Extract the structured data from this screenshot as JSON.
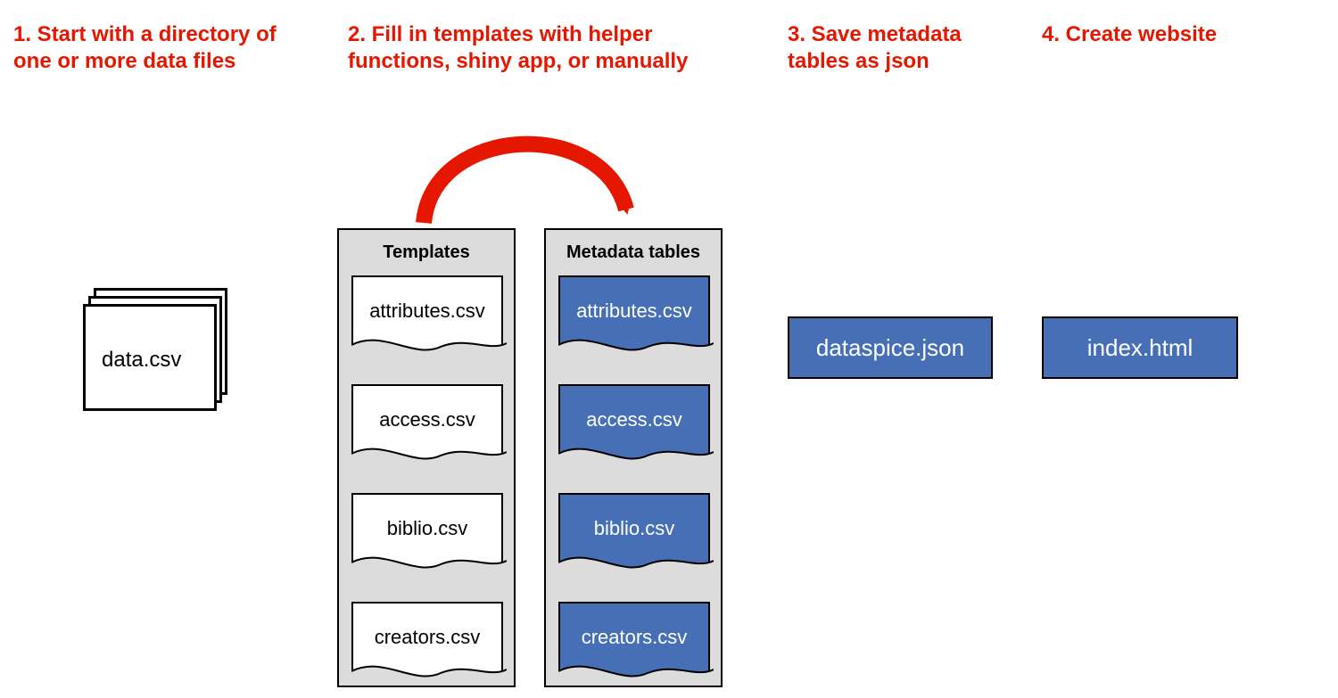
{
  "steps": {
    "s1": "1. Start with a directory of one or more data files",
    "s2": "2. Fill in templates with helper functions, shiny app, or manually",
    "s3": "3. Save metadata tables as json",
    "s4": "4. Create website"
  },
  "data_file": {
    "label": "data.csv"
  },
  "templates_panel": {
    "title": "Templates",
    "files": [
      "attributes.csv",
      "access.csv",
      "biblio.csv",
      "creators.csv"
    ]
  },
  "metadata_panel": {
    "title": "Metadata tables",
    "files": [
      "attributes.csv",
      "access.csv",
      "biblio.csv",
      "creators.csv"
    ]
  },
  "json_file": {
    "label": "dataspice.json"
  },
  "html_file": {
    "label": "index.html"
  },
  "colors": {
    "accent_red": "#e51700",
    "box_blue": "#466fb5",
    "panel_grey": "#dcdcdc"
  }
}
